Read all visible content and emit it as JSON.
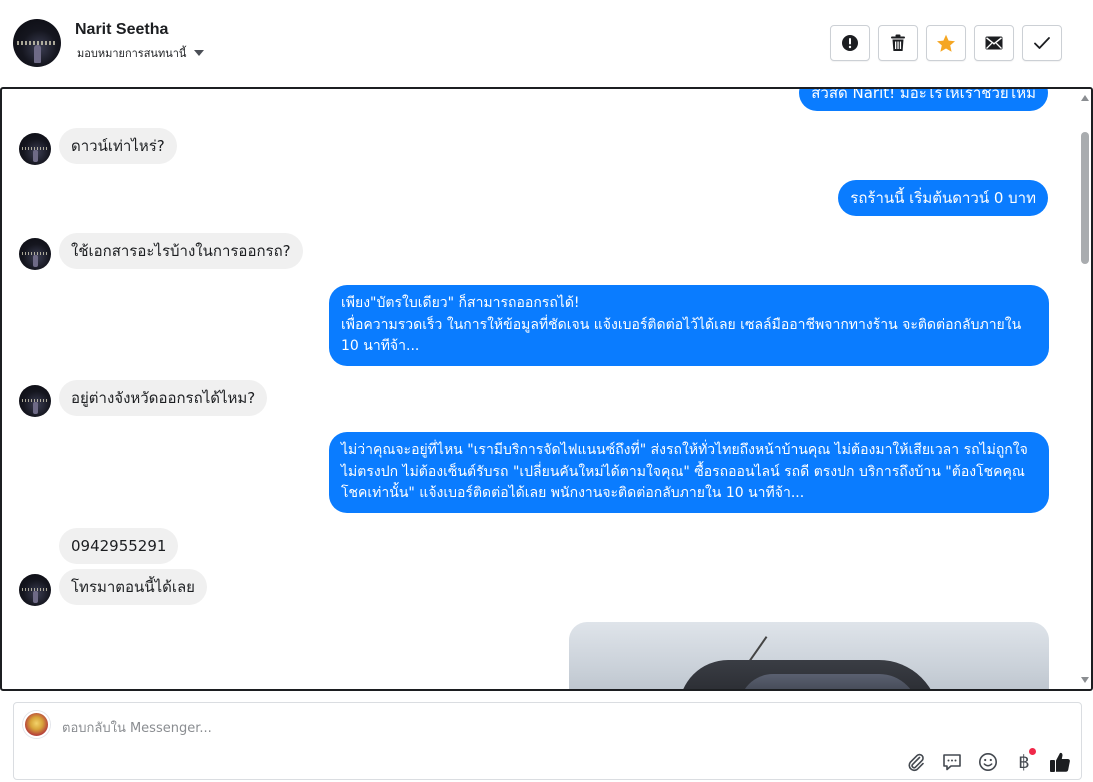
{
  "header": {
    "name": "Narit Seetha",
    "assign_label": "มอบหมายการสนทนานี้",
    "actions": [
      {
        "name": "report",
        "icon": "exclamation-circle-icon"
      },
      {
        "name": "delete",
        "icon": "trash-icon"
      },
      {
        "name": "star",
        "icon": "star-icon",
        "color": "#f5a623"
      },
      {
        "name": "mark-unread",
        "icon": "envelope-icon"
      },
      {
        "name": "done",
        "icon": "check-icon"
      }
    ]
  },
  "messages": {
    "m0": "สวัสดี Narit! มีอะไรให้เราช่วยไหม",
    "m1": "ดาวน์เท่าไหร่?",
    "m2": "รถร้านนี้ เริ่มต้นดาวน์ 0 บาท",
    "m3": "ใช้เอกสารอะไรบ้างในการออกรถ?",
    "m4_line1": "เพียง\"บัตรใบเดียว\" ก็สามารถออกรถได้!",
    "m4_line2": "เพื่อความรวดเร็ว ในการให้ข้อมูลที่ชัดเจน แจ้งเบอร์ติดต่อไว้ได้เลย เซลล์มืออาชีพจากทางร้าน จะติดต่อกลับภายใน 10 นาทีจ้า...",
    "m5": "อยู่ต่างจังหวัดออกรถได้ไหม?",
    "m6": "ไม่ว่าคุณจะอยู่ที่ไหน \"เรามีบริการจัดไฟแนนซ์ถึงที่\"  ส่งรถให้ทั่วไทยถึงหน้าบ้านคุณ ไม่ต้องมาให้เสียเวลา รถไม่ถูกใจ ไม่ตรงปก ไม่ต้องเซ็นต์รับรถ \"เปลี่ยนคันใหม่ได้ตามใจคุณ\" ซื้อรถออนไลน์ รถดี ตรงปก บริการถึงบ้าน \"ต้องโชคคุณโชคเท่านั้น\" แจ้งเบอร์ติดต่อได้เลย พนักงานจะติดต่อกลับภายใน 10 นาทีจ้า...",
    "m7": "0942955291",
    "m8": "โทรมาตอนนี้ได้เลย"
  },
  "composer": {
    "placeholder": "ตอบกลับใน Messenger...",
    "tools": [
      "paperclip-icon",
      "chat-bubble-icon",
      "emoji-icon",
      "baht-icon",
      "thumbs-up-icon"
    ],
    "baht_symbol": "฿"
  },
  "colors": {
    "outgoing": "#0a7cff",
    "incoming": "#f0f0f0",
    "star": "#f5a623",
    "badge": "#f02849"
  }
}
